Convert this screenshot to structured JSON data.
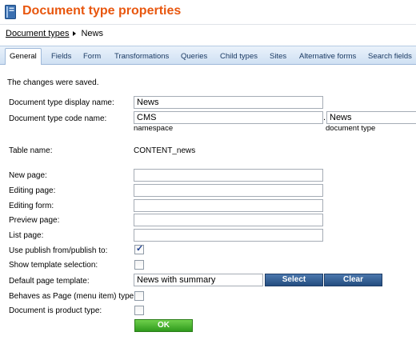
{
  "header": {
    "title": "Document type properties",
    "icon": "document-type-icon"
  },
  "breadcrumb": {
    "parent": "Document types",
    "current": "News"
  },
  "tabs": [
    {
      "label": "General",
      "active": true
    },
    {
      "label": "Fields"
    },
    {
      "label": "Form"
    },
    {
      "label": "Transformations"
    },
    {
      "label": "Queries"
    },
    {
      "label": "Child types"
    },
    {
      "label": "Sites"
    },
    {
      "label": "Alternative forms"
    },
    {
      "label": "Search fields"
    }
  ],
  "status_message": "The changes were saved.",
  "form": {
    "display_name": {
      "label": "Document type display name:",
      "value": "News"
    },
    "code_name": {
      "label": "Document type code name:",
      "namespace_value": "CMS",
      "namespace_hint": "namespace",
      "separator": ".",
      "type_value": "News",
      "type_hint": "document type"
    },
    "table_name": {
      "label": "Table name:",
      "value": "CONTENT_news"
    },
    "new_page": {
      "label": "New page:",
      "value": ""
    },
    "editing_page": {
      "label": "Editing page:",
      "value": ""
    },
    "editing_form": {
      "label": "Editing form:",
      "value": ""
    },
    "preview_page": {
      "label": "Preview page:",
      "value": ""
    },
    "list_page": {
      "label": "List page:",
      "value": ""
    },
    "use_publish": {
      "label": "Use publish from/publish to:",
      "checked": true
    },
    "show_template": {
      "label": "Show template selection:",
      "checked": false
    },
    "default_template": {
      "label": "Default page template:",
      "value": "News with summary",
      "select_label": "Select",
      "clear_label": "Clear"
    },
    "behaves_as_page": {
      "label": "Behaves as Page (menu item) type:",
      "checked": false
    },
    "is_product": {
      "label": "Document is product type:",
      "checked": false
    }
  },
  "ok_label": "OK",
  "colors": {
    "title": "#e8570f",
    "tab_bar": "#cfe0f3",
    "blue_button": "#244d80",
    "ok_button": "#2f9a1c"
  }
}
